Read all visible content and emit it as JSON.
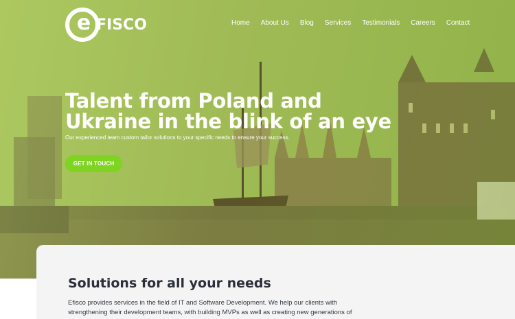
{
  "brand": {
    "logo_letter": "e",
    "logo_text": "FISCO"
  },
  "nav": {
    "items": [
      "Home",
      "About Us",
      "Blog",
      "Services",
      "Testimonials",
      "Careers",
      "Contact"
    ]
  },
  "hero": {
    "title": "Talent from Poland and Ukraine in the blink of an eye",
    "subtitle": "Our experienced team custom tailor solutions to your specific needs to ensure your success.",
    "cta_label": "GET IN TOUCH"
  },
  "section": {
    "title": "Solutions for all your needs",
    "body": "Efisco provides services in the field of IT and Software Development. We help our clients with strengthening their development teams, with building MVPs as well as creating new generations of clients' disruptive"
  },
  "colors": {
    "accent": "#7fd321",
    "overlay": "#a9c766",
    "card_bg": "#f4f4f4"
  }
}
